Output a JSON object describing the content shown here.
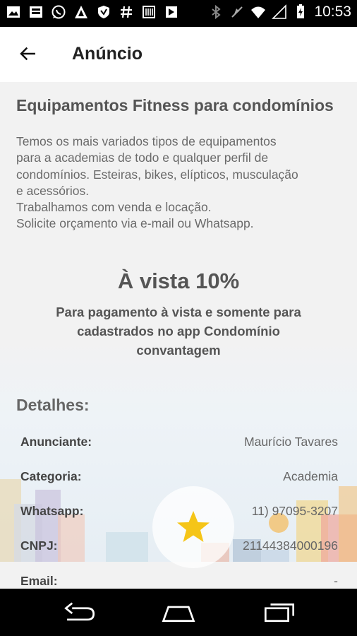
{
  "status_bar": {
    "time": "10:53",
    "icons": [
      "image-icon",
      "photo-icon",
      "whatsapp-icon",
      "notification-a-icon",
      "shield-icon",
      "hash-icon",
      "barcode-icon",
      "flag-icon",
      "bluetooth-icon",
      "mute-icon",
      "wifi-icon",
      "signal-icon",
      "battery-icon"
    ]
  },
  "toolbar": {
    "title": "Anúncio",
    "back_icon": "arrow-left-icon"
  },
  "ad": {
    "title": "Equipamentos Fitness para condomínios",
    "description_lines": [
      "Temos os mais variados tipos de equipamentos",
      "para a academias de todo e qualquer perfil de",
      "condomínios. Esteiras, bikes, elípticos, musculação",
      "e acessórios.",
      "Trabalhamos com venda e locação.",
      "Solicite orçamento via e-mail ou Whatsapp."
    ]
  },
  "promo": {
    "title": "À vista 10%",
    "text_lines": [
      "Para pagamento à vista e somente para",
      "cadastrados no app Condomínio",
      "convantagem"
    ]
  },
  "details": {
    "heading": "Detalhes:",
    "rows": [
      {
        "label": "Anunciante:",
        "value": "Maurício Tavares"
      },
      {
        "label": "Categoria:",
        "value": "Academia"
      },
      {
        "label": "Whatsapp:",
        "value": "11) 97095-3207"
      },
      {
        "label": "CNPJ:",
        "value": "21144384000196"
      },
      {
        "label": "Email:",
        "value": "-"
      }
    ]
  },
  "favorite": {
    "icon": "star-icon",
    "color": "#f5c518"
  },
  "nav_bar": {
    "icons": [
      "back-nav-icon",
      "home-nav-icon",
      "recents-nav-icon"
    ]
  }
}
